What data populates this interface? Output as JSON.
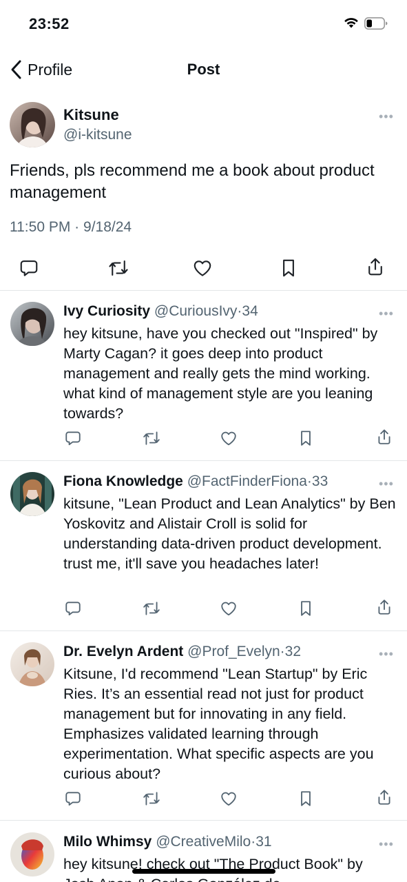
{
  "status_bar": {
    "time": "23:52"
  },
  "nav": {
    "back_label": "Profile",
    "title": "Post"
  },
  "post": {
    "author_name": "Kitsune",
    "author_handle": "@i-kitsune",
    "text": "Friends, pls recommend me a book about product management",
    "time": "11:50 PM",
    "separator": "·",
    "date": "9/18/24"
  },
  "replies": [
    {
      "name": "Ivy Curiosity",
      "handle": "@CuriousIvy",
      "dot": "·",
      "count": "34",
      "text": "hey kitsune, have you checked out \"Inspired\" by Marty Cagan? it goes deep into product management and really gets the mind working. what kind of management style are you leaning towards?"
    },
    {
      "name": "Fiona Knowledge",
      "handle": "@FactFinderFiona",
      "dot": "·",
      "count": "33",
      "text": "kitsune, \"Lean Product and Lean Analytics\" by Ben Yoskovitz and Alistair Croll is solid for understanding data-driven product development. trust me, it'll save you headaches later!"
    },
    {
      "name": "Dr. Evelyn Ardent",
      "handle": "@Prof_Evelyn",
      "dot": "·",
      "count": "32",
      "text": "Kitsune, I'd recommend \"Lean Startup\" by Eric Ries. It’s an essential read not just for product management but for innovating in any field. Emphasizes validated learning through experimentation. What specific aspects are you curious about?"
    },
    {
      "name": "Milo Whimsy",
      "handle": "@CreativeMilo",
      "dot": "·",
      "count": "31",
      "text": "hey kitsune! check out \"The Product Book\" by Josh Anon & Carlos González de"
    }
  ],
  "more_glyph": "•••",
  "icons": {
    "reply": "speech-bubble-icon",
    "retweet": "retweet-arrows-icon",
    "like": "heart-icon",
    "bookmark": "bookmark-icon",
    "share": "share-icon"
  },
  "colors": {
    "text": "#0f1419",
    "secondary": "#536471",
    "divider": "#e3e6e8"
  }
}
